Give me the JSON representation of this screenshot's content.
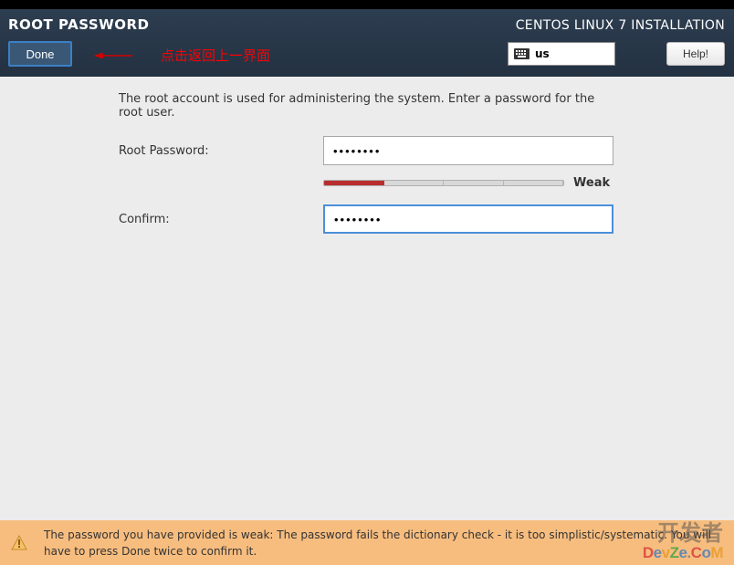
{
  "header": {
    "page_title": "ROOT PASSWORD",
    "installer_title": "CENTOS LINUX 7 INSTALLATION",
    "done_label": "Done",
    "help_label": "Help!",
    "keyboard_layout": "us",
    "annotation_text": "点击返回上一界面"
  },
  "content": {
    "instruction": "The root account is used for administering the system.   Enter a password for the root user.",
    "password_label": "Root Password:",
    "confirm_label": "Confirm:",
    "password_value": "••••••••",
    "confirm_value": "••••••••",
    "strength_label": "Weak",
    "strength_percent": 25
  },
  "warning": {
    "text": "The password you have provided is weak: The password fails the dictionary check - it is too simplistic/systematic. You will have to press Done twice to confirm it."
  },
  "watermark": {
    "cn": "开发者",
    "en": "DevZe.CoM"
  }
}
